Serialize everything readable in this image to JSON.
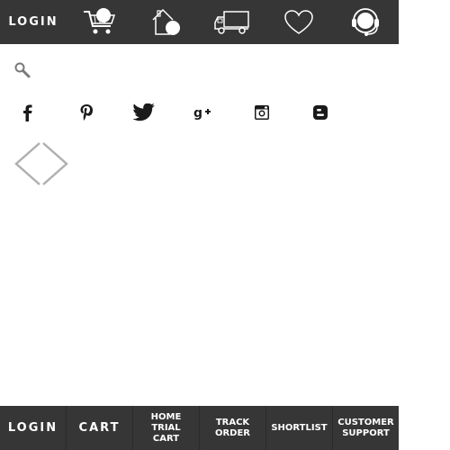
{
  "header": {
    "login_label": "LOGIN",
    "icons": [
      "cart-icon",
      "home-trial-cart-icon",
      "track-order-truck-icon",
      "shortlist-heart-icon",
      "customer-support-headset-icon"
    ]
  },
  "search": {
    "icon": "search-icon"
  },
  "social": {
    "icons": [
      "facebook-icon",
      "pinterest-icon",
      "twitter-icon",
      "google-plus-icon",
      "instagram-icon",
      "blogger-icon"
    ]
  },
  "carousel": {
    "prev_icon": "chevron-left-icon",
    "next_icon": "chevron-right-icon"
  },
  "footer_nav": {
    "items": [
      {
        "label": "LOGIN"
      },
      {
        "label": "CART"
      },
      {
        "label": "HOME\nTRIAL\nCART"
      },
      {
        "label": "TRACK\nORDER"
      },
      {
        "label": "SHORTLIST"
      },
      {
        "label": "CUSTOMER\nSUPPORT"
      }
    ]
  },
  "colors": {
    "bar_background": "#363636",
    "bar_text": "#ffffff",
    "icon_dark": "#1a1a1a",
    "icon_gray": "#7a7a7a",
    "arrow_stroke": "#b0b0b0"
  }
}
